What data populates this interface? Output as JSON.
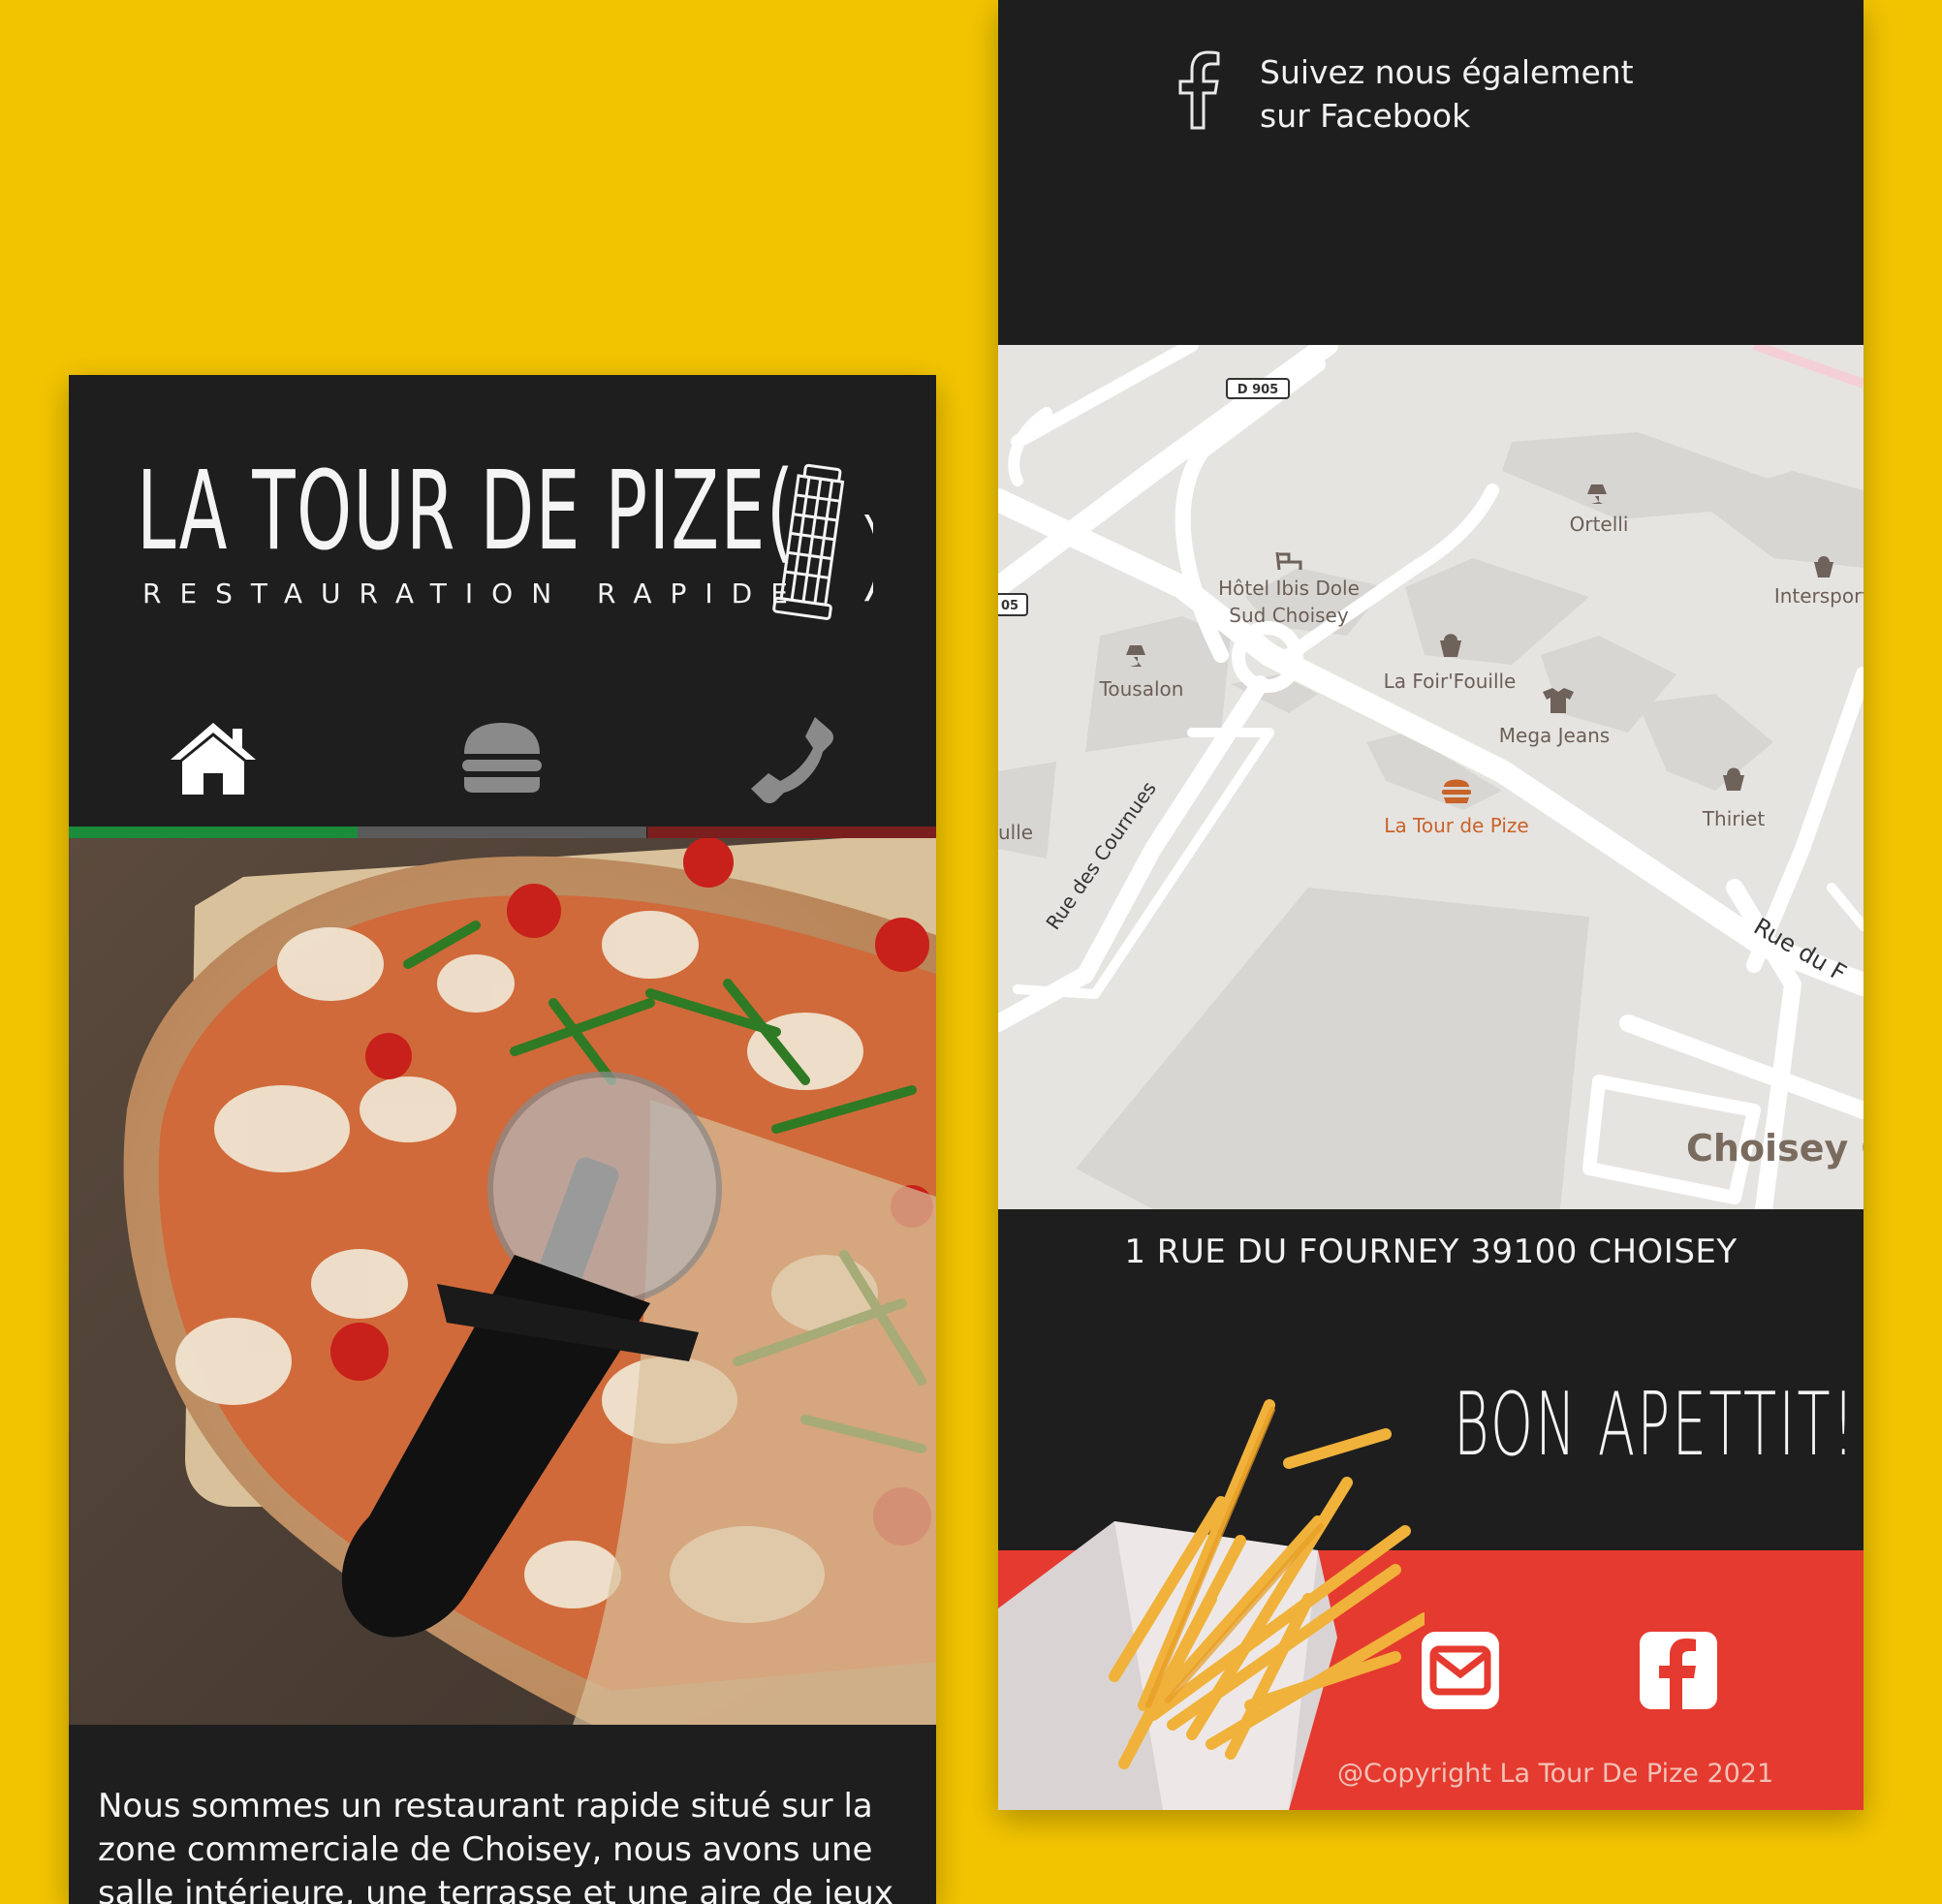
{
  "left_phone": {
    "logo": {
      "title": "LA TOUR DE PIZE(",
      "close_paren": ")",
      "subtitle": "RESTAURATION RAPIDE"
    },
    "nav": [
      {
        "icon": "home-icon",
        "active": true
      },
      {
        "icon": "burger-icon",
        "active": false
      },
      {
        "icon": "phone-icon",
        "active": false
      }
    ],
    "stripe_colors": [
      "#1a8c3a",
      "#5a5a5a",
      "#7a1e1e"
    ],
    "description": "Nous sommes un restaurant rapide situé sur la zone commerciale de Choisey, nous avons une salle intérieure, une terrasse et une aire de jeux"
  },
  "right_phone": {
    "facebook_follow": {
      "line1": "Suivez nous également",
      "line2": "sur Facebook"
    },
    "map": {
      "road_badges": [
        "D 905",
        "05"
      ],
      "places": [
        {
          "name": "Ortelli"
        },
        {
          "name": "Intersport"
        },
        {
          "name": "Hôtel Ibis Dole",
          "name2": "Sud Choisey"
        },
        {
          "name": "Tousalon"
        },
        {
          "name": "La Foir'Fouille"
        },
        {
          "name": "Mega Jeans"
        },
        {
          "name": "La Tour de Pize"
        },
        {
          "name": "Thiriet"
        },
        {
          "name": "ulle"
        }
      ],
      "streets": [
        "Rue des Cournues",
        "Rue du F"
      ],
      "area": "Choisey C"
    },
    "address": "1 RUE DU FOURNEY  39100 CHOISEY",
    "bon_appetit": "BON APETTIT!",
    "social": [
      "email-icon",
      "facebook-icon"
    ],
    "copyright": "@Copyright La Tour De Pize 2021"
  },
  "colors": {
    "background": "#f2c400",
    "panel": "#1e1e1e",
    "red": "#e53a2f",
    "map_highlight": "#c8632a"
  }
}
